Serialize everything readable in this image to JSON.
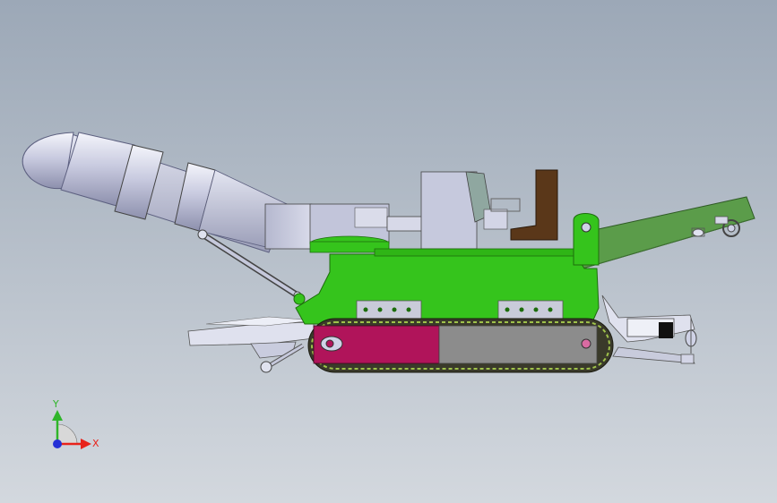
{
  "triad": {
    "x_label": "X",
    "y_label": "Y",
    "x_color": "#e8221b",
    "y_color": "#2fb52a",
    "z_color": "#2530d6"
  },
  "colors": {
    "body_green": "#35c41c",
    "track_dark": "#3a3a2a",
    "track_panel_magenta": "#b0145a",
    "track_panel_grey": "#8c8c8c",
    "metal_light": "#cfd2e6",
    "metal_mid": "#a7abc4",
    "seat_brown": "#5a3719",
    "conveyor_green": "#5b9c4a"
  }
}
